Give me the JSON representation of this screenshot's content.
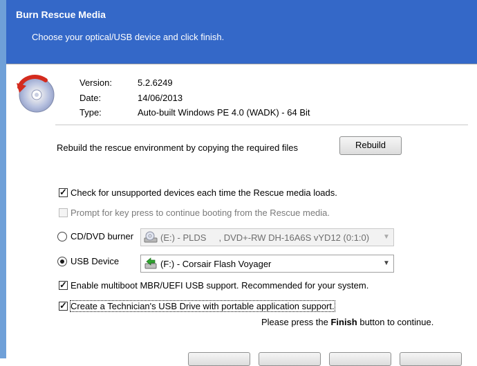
{
  "window": {
    "title": "Burn Rescue Media",
    "subtitle": "Choose your optical/USB device and click finish."
  },
  "info": {
    "version_label": "Version:",
    "version_value": "5.2.6249",
    "date_label": "Date:",
    "date_value": "14/06/2013",
    "type_label": "Type:",
    "type_value": "Auto-built Windows PE 4.0 (WADK) - 64 Bit"
  },
  "rebuild": {
    "description": "Rebuild the rescue environment by copying the required files",
    "button_label": "Rebuild"
  },
  "options": {
    "check_unsupported": "Check for unsupported devices each time the Rescue media loads.",
    "prompt_keypress": "Prompt for key press to continue booting from the Rescue media."
  },
  "devices": {
    "cd_label": "CD/DVD burner",
    "cd_value": "(E:) - PLDS     , DVD+-RW DH-16A6S vYD12 (0:1:0)",
    "usb_label": "USB Device",
    "usb_value": "(F:) - Corsair Flash Voyager"
  },
  "usb_options": {
    "multiboot": "Enable multiboot MBR/UEFI USB support. Recommended for your system.",
    "technician": "Create a Technician's USB Drive with portable application support."
  },
  "footer": {
    "prefix": "Please press the ",
    "finish_word": "Finish",
    "suffix": " button to continue."
  },
  "colors": {
    "header_bg": "#3468c8",
    "frame": "#6fa0d8"
  },
  "icons": {
    "logo": "rescue-disc-icon",
    "cd": "cd-drive-icon",
    "usb": "usb-drive-icon"
  }
}
